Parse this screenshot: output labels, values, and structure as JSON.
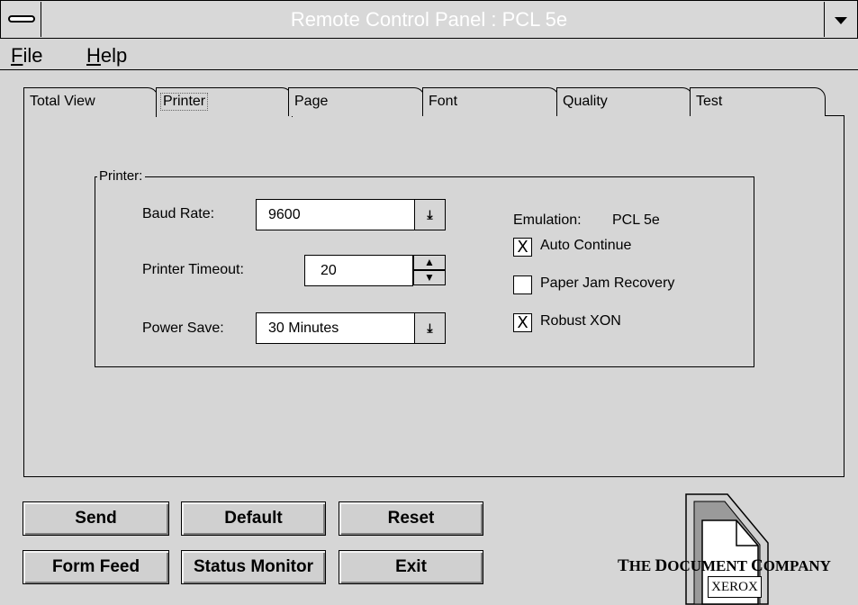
{
  "window": {
    "title": "Remote Control Panel : PCL 5e"
  },
  "menu": {
    "file": {
      "mnemonic": "F",
      "rest": "ile"
    },
    "help": {
      "mnemonic": "H",
      "rest": "elp"
    }
  },
  "tabs": [
    {
      "label": "Total View"
    },
    {
      "label": "Printer",
      "active": true
    },
    {
      "label": "Page"
    },
    {
      "label": "Font"
    },
    {
      "label": "Quality"
    },
    {
      "label": "Test"
    }
  ],
  "printer_group": {
    "legend": "Printer:",
    "baud_rate": {
      "label": "Baud Rate:",
      "value": "9600"
    },
    "printer_timeout": {
      "label": "Printer Timeout:",
      "value": "20"
    },
    "power_save": {
      "label": "Power Save:",
      "value": "30 Minutes"
    },
    "emulation": {
      "label": "Emulation:",
      "value": "PCL 5e"
    },
    "auto_continue": {
      "label": "Auto Continue",
      "checked": true,
      "mark": "X"
    },
    "paper_jam_recovery": {
      "label": "Paper Jam Recovery",
      "checked": false,
      "mark": ""
    },
    "robust_xon": {
      "label": "Robust XON",
      "checked": true,
      "mark": "X"
    }
  },
  "buttons": {
    "send": "Send",
    "default": "Default",
    "reset": "Reset",
    "form_feed": "Form Feed",
    "status_monitor": "Status Monitor",
    "exit": "Exit"
  },
  "logo": {
    "tagline_parts": [
      "T",
      "HE ",
      "D",
      "OCUMENT ",
      "C",
      "OMPANY"
    ],
    "brand": "XEROX"
  }
}
